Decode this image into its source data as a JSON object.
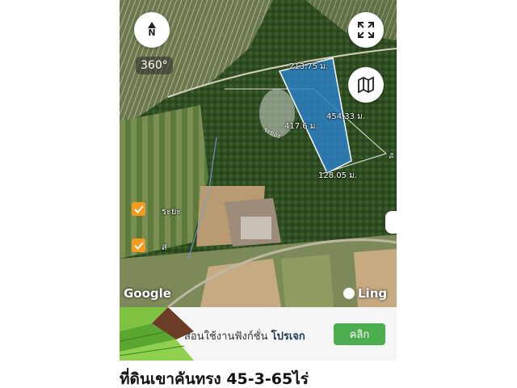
{
  "map": {
    "compass_letter": "N",
    "view_360": "360°",
    "dimensions": {
      "top": "213.75 ม.",
      "right": "454.33 ม.",
      "left": "417.6 ม.",
      "bottom": "128.05 ม."
    },
    "road_label": "ระยอง",
    "road_label_right": "ระ",
    "place_1": "ระยะ",
    "place_2": "ส",
    "google": "Google",
    "ling": "Ling",
    "parcel_color": "#2b7fc4"
  },
  "banner": {
    "text_prefix": "สอนใช้งานฟังก์ชั่น",
    "text_bold": "โปรเจก",
    "button": "คลิก",
    "button_color": "#4cae4f"
  },
  "title": "ที่ดินเขาคันทรง 45-3-65ไร่"
}
